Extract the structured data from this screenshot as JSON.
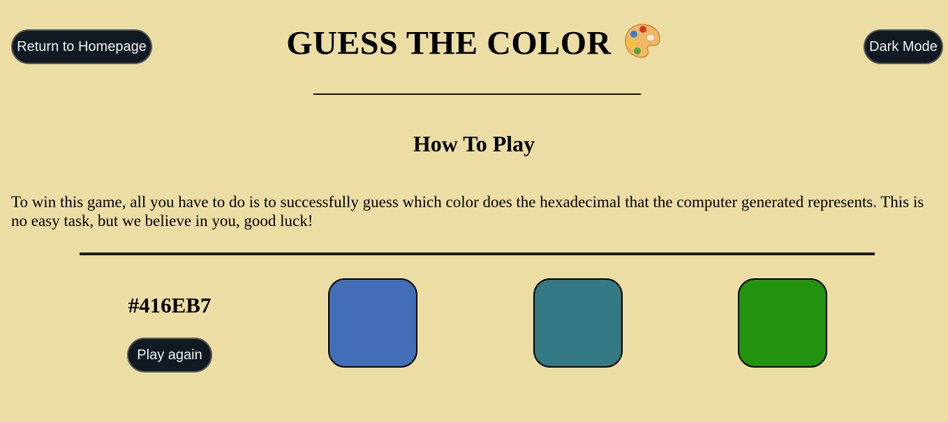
{
  "header": {
    "return_label": "Return to Homepage",
    "title": "GUESS THE COLOR",
    "title_icon": "artist-palette-icon",
    "dark_mode_label": "Dark Mode"
  },
  "how_to_play": {
    "heading": "How To Play",
    "text": "To win this game, all you have to do is to successfully guess which color does the hexadecimal that the computer generated represents. This is no easy task, but we believe in you, good luck!"
  },
  "game": {
    "hex_code": "#416EB7",
    "play_again_label": "Play again",
    "options": [
      {
        "color": "#416eb7"
      },
      {
        "color": "#357984"
      },
      {
        "color": "#23920e"
      }
    ]
  },
  "colors": {
    "background": "#ecdda4",
    "button_bg": "#111a22",
    "button_text": "#f2f2f2"
  }
}
